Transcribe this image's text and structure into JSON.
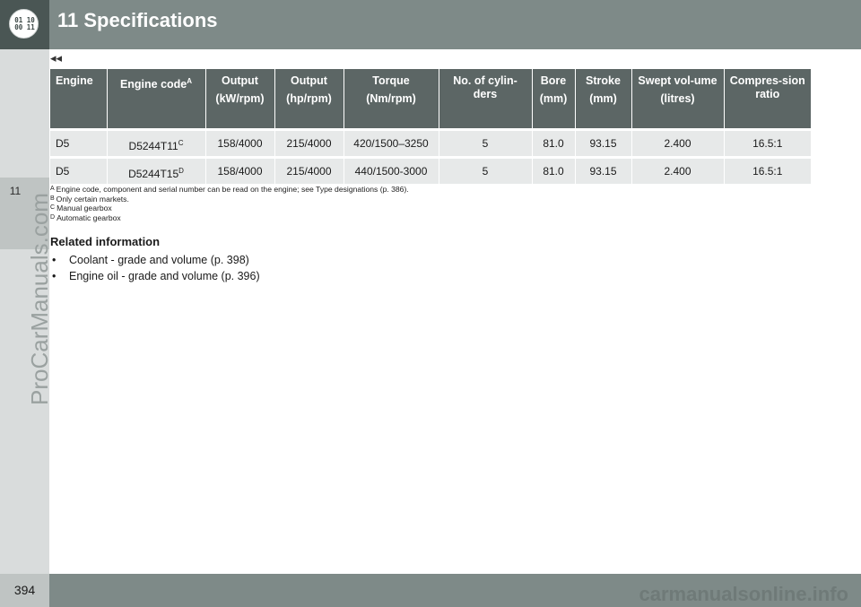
{
  "header": {
    "logo_lines": [
      "01 10",
      "00 11"
    ],
    "chapter_title": "11 Specifications"
  },
  "sidebar": {
    "chapter_number": "11"
  },
  "watermark": "ProCarManuals.com",
  "continuation_marker": "◂◂",
  "table": {
    "columns": [
      {
        "label": "Engine",
        "sub": ""
      },
      {
        "label": "Engine code",
        "sup": "A",
        "sub": ""
      },
      {
        "label": "Output",
        "sub": "(kW/rpm)"
      },
      {
        "label": "Output",
        "sub": "(hp/rpm)"
      },
      {
        "label": "Torque",
        "sub": "(Nm/rpm)"
      },
      {
        "label": "No. of cylin-ders",
        "sub": ""
      },
      {
        "label": "Bore",
        "sub": "(mm)"
      },
      {
        "label": "Stroke",
        "sub": "(mm)"
      },
      {
        "label": "Swept vol-ume",
        "sub": "(litres)"
      },
      {
        "label": "Compres-sion ratio",
        "sub": ""
      }
    ],
    "rows": [
      {
        "engine": "D5",
        "code": "D5244T11",
        "code_sup": "C",
        "kw": "158/4000",
        "hp": "215/4000",
        "torque": "420/1500–3250",
        "cyl": "5",
        "bore": "81.0",
        "stroke": "93.15",
        "vol": "2.400",
        "ratio": "16.5:1"
      },
      {
        "engine": "D5",
        "code": "D5244T15",
        "code_sup": "D",
        "kw": "158/4000",
        "hp": "215/4000",
        "torque": "440/1500-3000",
        "cyl": "5",
        "bore": "81.0",
        "stroke": "93.15",
        "vol": "2.400",
        "ratio": "16.5:1"
      }
    ]
  },
  "footnotes": [
    {
      "mark": "A",
      "text": "Engine code, component and serial number can be read on the engine; see Type designations (p. 386)."
    },
    {
      "mark": "B",
      "text": "Only certain markets."
    },
    {
      "mark": "C",
      "text": "Manual gearbox"
    },
    {
      "mark": "D",
      "text": "Automatic gearbox"
    }
  ],
  "related": {
    "heading": "Related information",
    "bullet": "•",
    "items": [
      "Coolant - grade and volume (p. 398)",
      "Engine oil - grade and volume (p. 396)"
    ]
  },
  "footer": {
    "page_number": "394",
    "watermark": "carmanualsonline.info"
  },
  "colors": {
    "header_bar": "#7e8a88",
    "table_header": "#5c6665",
    "table_cell": "#e7e9e9"
  }
}
